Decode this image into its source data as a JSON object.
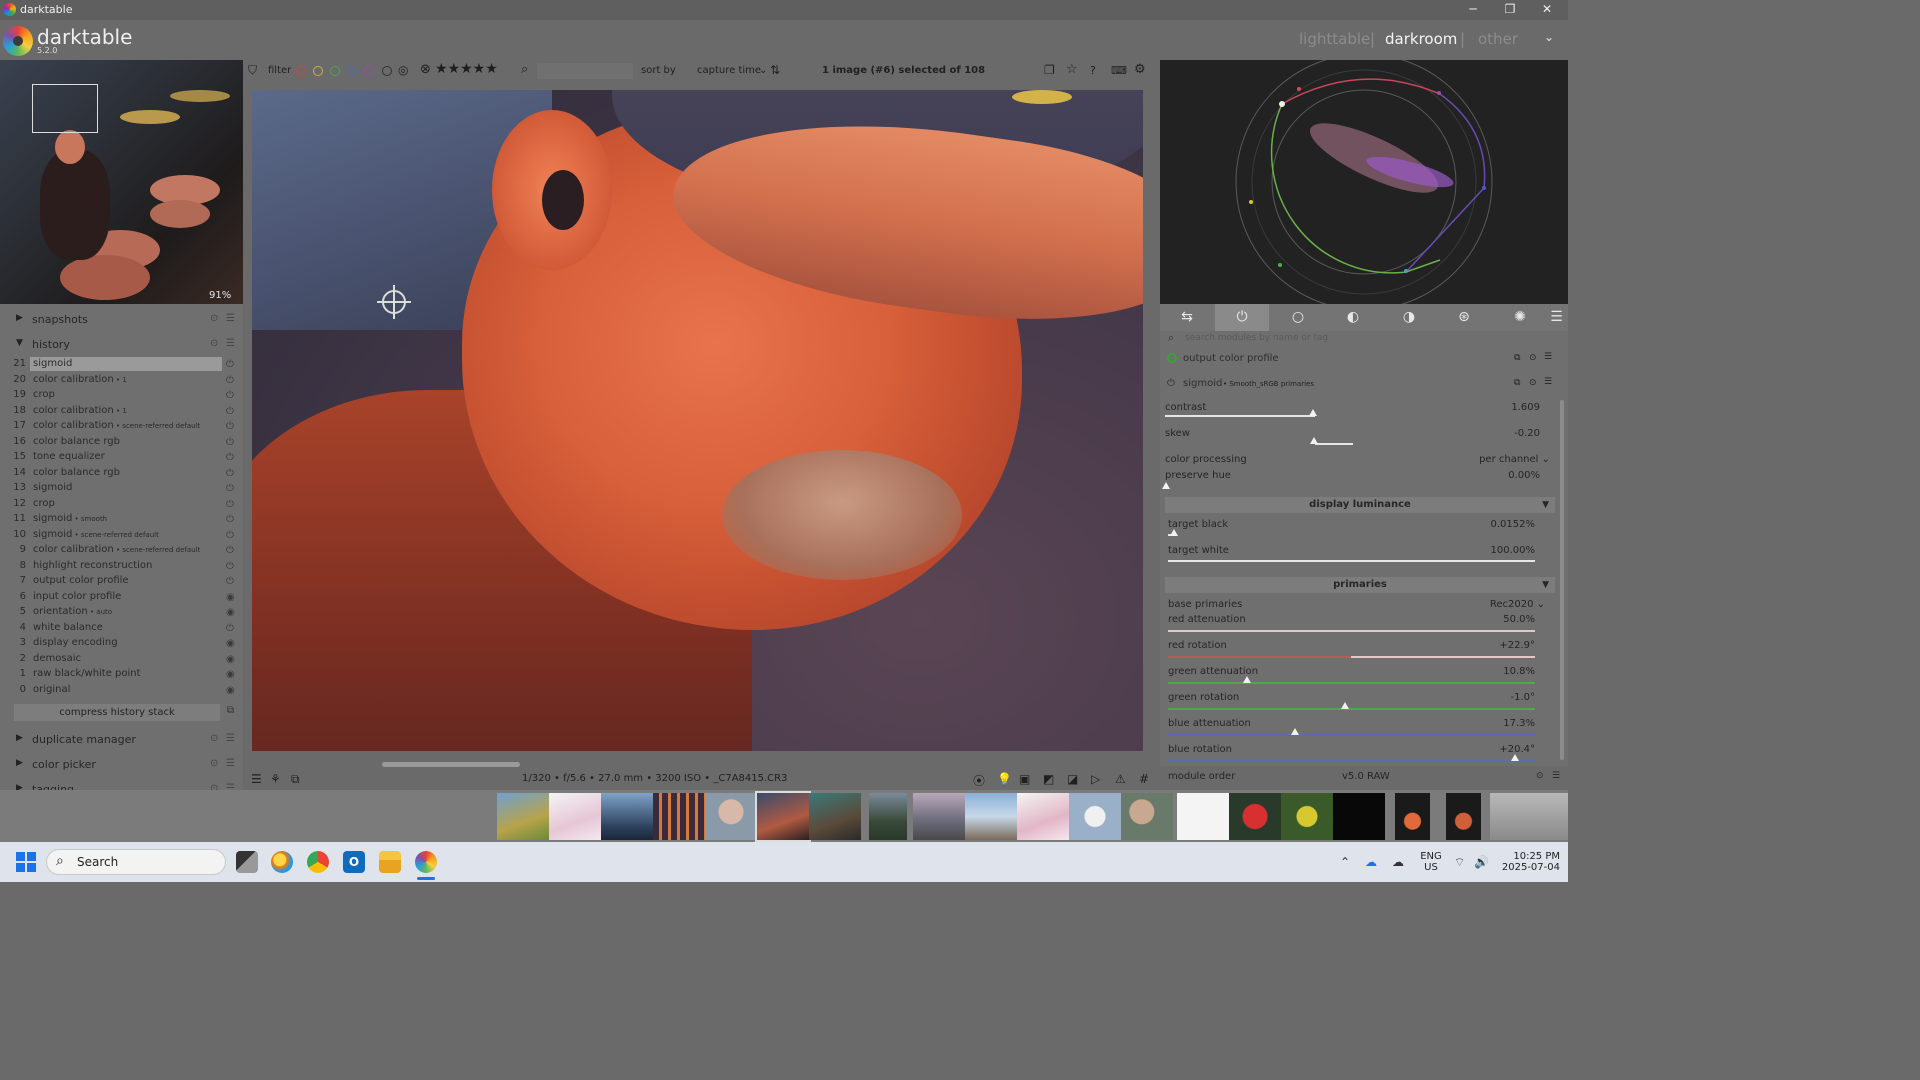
{
  "window": {
    "title": "darktable",
    "min_label": "─",
    "max_label": "❐",
    "close_label": "✕"
  },
  "app": {
    "name": "darktable",
    "version": "5.2.0"
  },
  "views": [
    "lighttable",
    "darkroom",
    "other"
  ],
  "view_separators": [
    "|",
    "|"
  ],
  "active_view": "darkroom",
  "view_menu_icon": "chevron-down-icon",
  "navigation": {
    "zoom": "91%"
  },
  "left_sections": {
    "snapshots": "snapshots",
    "history": "history",
    "duplicate_manager": "duplicate manager",
    "color_picker": "color picker",
    "tagging": "tagging"
  },
  "history": [
    {
      "num": "21",
      "name": "sigmoid",
      "sub": "",
      "selected": true
    },
    {
      "num": "20",
      "name": "color calibration",
      "sub": " • 1"
    },
    {
      "num": "19",
      "name": "crop",
      "sub": ""
    },
    {
      "num": "18",
      "name": "color calibration",
      "sub": " • 1"
    },
    {
      "num": "17",
      "name": "color calibration",
      "sub": " • scene-referred default"
    },
    {
      "num": "16",
      "name": "color balance rgb",
      "sub": ""
    },
    {
      "num": "15",
      "name": "tone equalizer",
      "sub": ""
    },
    {
      "num": "14",
      "name": "color balance rgb",
      "sub": ""
    },
    {
      "num": "13",
      "name": "sigmoid",
      "sub": ""
    },
    {
      "num": "12",
      "name": "crop",
      "sub": ""
    },
    {
      "num": "11",
      "name": "sigmoid",
      "sub": " • smooth"
    },
    {
      "num": "10",
      "name": "sigmoid",
      "sub": " • scene-referred default"
    },
    {
      "num": "9",
      "name": "color calibration",
      "sub": " • scene-referred default"
    },
    {
      "num": "8",
      "name": "highlight reconstruction",
      "sub": ""
    },
    {
      "num": "7",
      "name": "output color profile",
      "sub": ""
    },
    {
      "num": "6",
      "name": "input color profile",
      "sub": ""
    },
    {
      "num": "5",
      "name": "orientation",
      "sub": " • auto"
    },
    {
      "num": "4",
      "name": "white balance",
      "sub": ""
    },
    {
      "num": "3",
      "name": "display encoding",
      "sub": ""
    },
    {
      "num": "2",
      "name": "demosaic",
      "sub": ""
    },
    {
      "num": "1",
      "name": "raw black/white point",
      "sub": ""
    },
    {
      "num": "0",
      "name": "original",
      "sub": ""
    }
  ],
  "compress_label": "compress history stack",
  "topbar": {
    "filter_label": "filter",
    "rating_reject": "⊗",
    "rating_stars": "★★★★★",
    "sort_label": "sort by",
    "sort_value": "capture time",
    "count_prefix": "1 image (",
    "count_id": "#6",
    "count_mid": ") selected of ",
    "count_total": "108"
  },
  "image_info": "1/320 • f/5.6 • 27.0 mm • 3200 ISO • _C7A8415.CR3",
  "modules": {
    "search_placeholder": "search modules by name or tag",
    "output_color_profile": "output color profile",
    "sigmoid_name": "sigmoid",
    "sigmoid_preset": " • Smooth_sRGB primaries",
    "module_order_label": "module order",
    "module_order_value": "v5.0 RAW"
  },
  "sigmoid": {
    "contrast": {
      "label": "contrast",
      "value": "1.609",
      "frac": 0.4
    },
    "skew": {
      "label": "skew",
      "value": "-0.20",
      "frac": 0.4
    },
    "color_processing": {
      "label": "color processing",
      "value": "per channel"
    },
    "preserve_hue": {
      "label": "preserve hue",
      "value": "0.00%",
      "frac": 0.0
    },
    "display_luminance": "display luminance",
    "target_black": {
      "label": "target black",
      "value": "0.0152%",
      "frac": 0.02
    },
    "target_white": {
      "label": "target white",
      "value": "100.00%",
      "frac": 1.0
    },
    "primaries": "primaries",
    "base_primaries": {
      "label": "base primaries",
      "value": "Rec2020"
    },
    "red_attenuation": {
      "label": "red attenuation",
      "value": "50.0%",
      "frac": 1.0
    },
    "red_rotation": {
      "label": "red rotation",
      "value": "+22.9°",
      "frac": 1.0
    },
    "green_attenuation": {
      "label": "green attenuation",
      "value": "10.8%",
      "frac": 0.22
    },
    "green_rotation": {
      "label": "green rotation",
      "value": "-1.0°",
      "frac": 0.49
    },
    "blue_attenuation": {
      "label": "blue attenuation",
      "value": "17.3%",
      "frac": 0.35
    },
    "blue_rotation": {
      "label": "blue rotation",
      "value": "+20.4°",
      "frac": 0.95
    }
  },
  "colors": {
    "red_track": "#b85b5b",
    "green_track": "#4fa84f",
    "blue_track": "#5a6ab8"
  },
  "taskbar": {
    "search_label": "Search",
    "lang": "ENG",
    "region": "US",
    "time": "10:25 PM",
    "date": "2025-07-04"
  }
}
